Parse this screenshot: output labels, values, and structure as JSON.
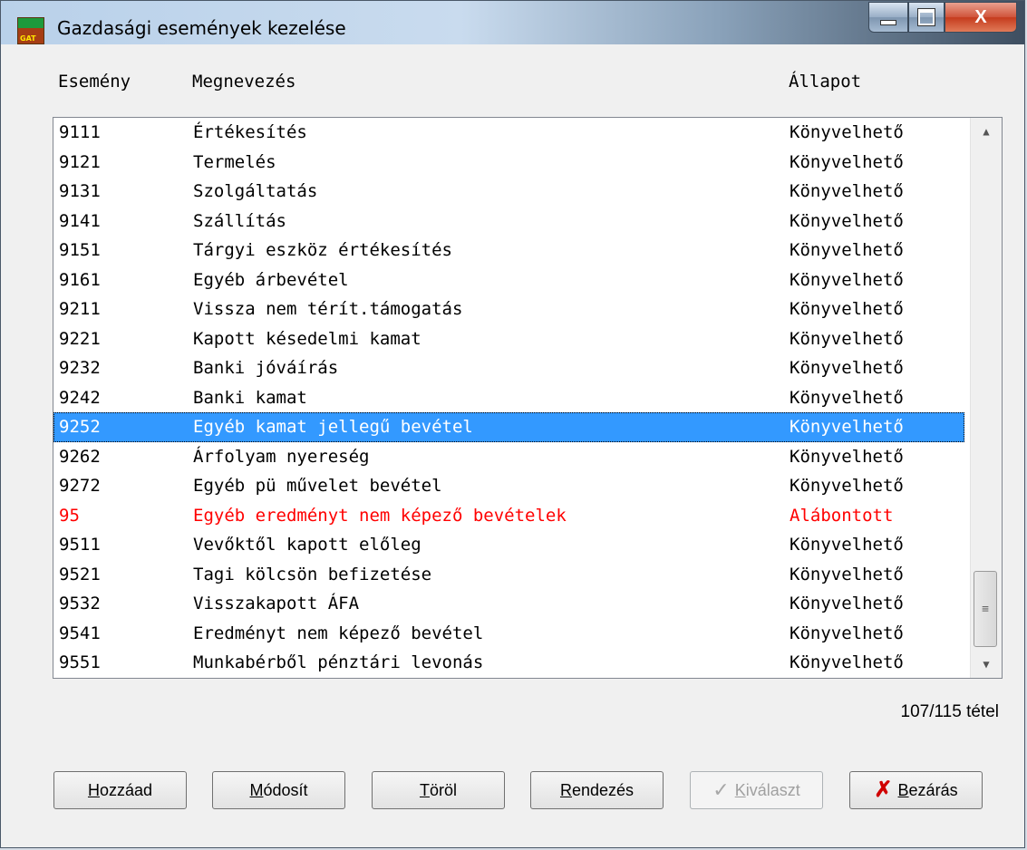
{
  "window": {
    "title": "Gazdasági események kezelése",
    "icon": "app-logo",
    "icon_text": "GAT"
  },
  "caption": {
    "close_label": "X"
  },
  "columns": [
    "Esemény",
    "Megnevezés",
    "Állapot"
  ],
  "rows": [
    {
      "code": "9111",
      "name": "Értékesítés",
      "status": "Könyvelhető"
    },
    {
      "code": "9121",
      "name": "Termelés",
      "status": "Könyvelhető"
    },
    {
      "code": "9131",
      "name": "Szolgáltatás",
      "status": "Könyvelhető"
    },
    {
      "code": "9141",
      "name": "Szállítás",
      "status": "Könyvelhető"
    },
    {
      "code": "9151",
      "name": "Tárgyi eszköz értékesítés",
      "status": "Könyvelhető"
    },
    {
      "code": "9161",
      "name": "Egyéb árbevétel",
      "status": "Könyvelhető"
    },
    {
      "code": "9211",
      "name": "Vissza nem térít.támogatás",
      "status": "Könyvelhető"
    },
    {
      "code": "9221",
      "name": "Kapott késedelmi kamat",
      "status": "Könyvelhető"
    },
    {
      "code": "9232",
      "name": "Banki jóváírás",
      "status": "Könyvelhető"
    },
    {
      "code": "9242",
      "name": "Banki kamat",
      "status": "Könyvelhető"
    },
    {
      "code": "9252",
      "name": "Egyéb kamat jellegű bevétel",
      "status": "Könyvelhető",
      "selected": true
    },
    {
      "code": "9262",
      "name": "Árfolyam nyereség",
      "status": "Könyvelhető"
    },
    {
      "code": "9272",
      "name": "Egyéb pü művelet bevétel",
      "status": "Könyvelhető"
    },
    {
      "code": "95",
      "name": "Egyéb eredményt nem képező bevételek",
      "status": "Alábontott",
      "color": "#ff0000"
    },
    {
      "code": "9511",
      "name": "Vevőktől kapott előleg",
      "status": "Könyvelhető"
    },
    {
      "code": "9521",
      "name": "Tagi kölcsön befizetése",
      "status": "Könyvelhető"
    },
    {
      "code": "9532",
      "name": "Visszakapott ÁFA",
      "status": "Könyvelhető"
    },
    {
      "code": "9541",
      "name": "Eredményt nem képező bevétel",
      "status": "Könyvelhető"
    },
    {
      "code": "9551",
      "name": "Munkabérből pénztári levonás",
      "status": "Könyvelhető"
    }
  ],
  "selection_color": "#3399ff",
  "count_label": "107/115 tétel",
  "buttons": {
    "add": {
      "hotkey": "H",
      "rest": "ozzáad"
    },
    "modify": {
      "hotkey": "M",
      "rest": "ódosít"
    },
    "delete": {
      "hotkey": "T",
      "rest": "öröl"
    },
    "sort": {
      "hotkey": "R",
      "rest": "endezés"
    },
    "select": {
      "hotkey": "K",
      "rest": "iválaszt",
      "disabled": true,
      "icon": "check-icon"
    },
    "close": {
      "hotkey": "B",
      "rest": "ezárás",
      "icon": "x-icon"
    }
  }
}
